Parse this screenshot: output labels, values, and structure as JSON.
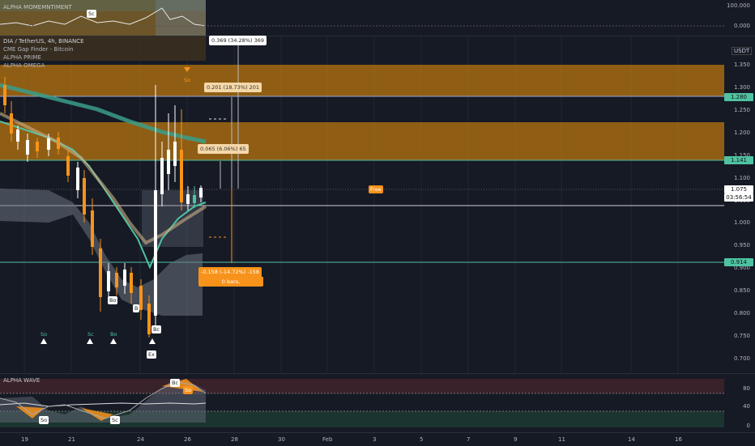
{
  "momentum": {
    "title": "ALPHA MOMEMNTIMENT",
    "ticks": [
      "100.000",
      "0.000"
    ],
    "marker": "Sc"
  },
  "legend": [
    "DIA / TetherUS, 4h, BINANCE",
    "CME Gap Finder - Bitcoin",
    "ALPHA PRIME",
    "ALPHA OMEGA"
  ],
  "price_axis": {
    "ticks": [
      "1.350",
      "1.300",
      "1.250",
      "1.200",
      "1.150",
      "1.100",
      "1.050",
      "1.000",
      "0.950",
      "0.900",
      "0.850",
      "0.800",
      "0.750",
      "0.700"
    ],
    "badges": {
      "b1280": "1.280",
      "b1141": "1.141",
      "current": "1.075",
      "countdown": "03:56:54",
      "b0914": "0.914"
    },
    "unit": "USDT"
  },
  "measures": {
    "m1": "0.369 (34.28%) 369",
    "m2": "0.201 (18.73%) 201",
    "m3": "0.065 (6.06%) 65",
    "m4": "-0.158 (-14.72%) -158",
    "m4b": "0 bars,"
  },
  "markers": {
    "so_top": "So",
    "bo1": "Bo",
    "b": "B",
    "bc": "Bc",
    "ex": "Ex",
    "so_lbl": "So",
    "sc_lbl": "Sc",
    "bo_lbl": "Bo",
    "free": "Free"
  },
  "wave": {
    "title": "ALPHA WAVE",
    "ticks": [
      "80",
      "40",
      "0"
    ],
    "labels": [
      "So",
      "Sc",
      "Bc",
      "So"
    ]
  },
  "time_axis": [
    "19",
    "21",
    "24",
    "26",
    "28",
    "30",
    "Feb",
    "3",
    "5",
    "7",
    "9",
    "11",
    "14",
    "16"
  ],
  "colors": {
    "orange": "#f7931a",
    "teal": "#4fc3a1",
    "bg": "#161a25"
  }
}
